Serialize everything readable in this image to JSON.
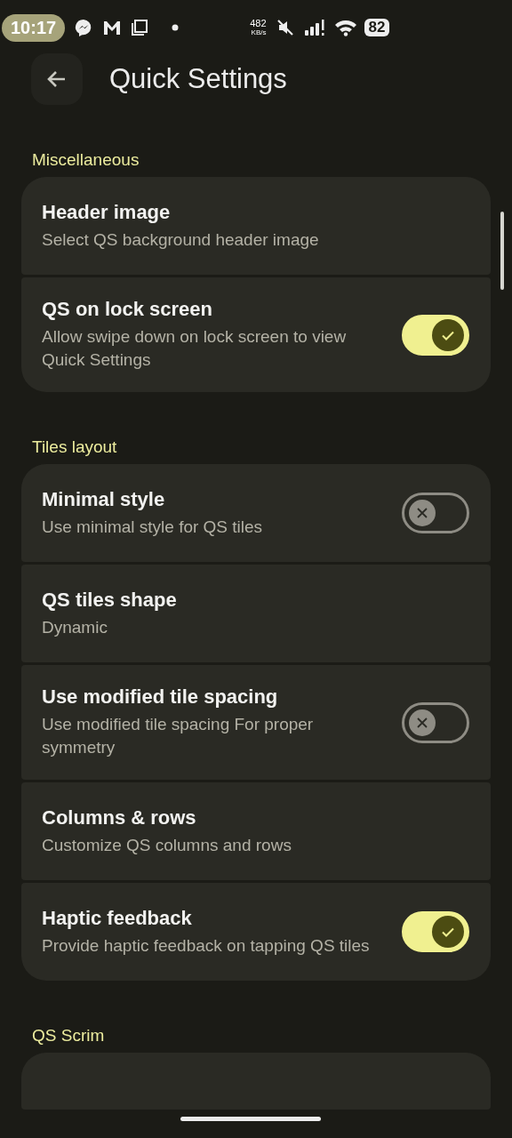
{
  "status_bar": {
    "time": "10:17",
    "speed": "482",
    "speed_unit": "KB/s",
    "battery": "82"
  },
  "header": {
    "title": "Quick Settings"
  },
  "sections": [
    {
      "title": "Miscellaneous",
      "items": [
        {
          "kind": "link",
          "title": "Header image",
          "subtitle": "Select QS background header image"
        },
        {
          "kind": "switch",
          "title": "QS on lock screen",
          "subtitle": "Allow swipe down on lock screen to view Quick Settings",
          "on": true
        }
      ]
    },
    {
      "title": "Tiles layout",
      "items": [
        {
          "kind": "switch",
          "title": "Minimal style",
          "subtitle": "Use minimal style for QS tiles",
          "on": false
        },
        {
          "kind": "link",
          "title": "QS tiles shape",
          "subtitle": "Dynamic"
        },
        {
          "kind": "switch",
          "title": "Use modified tile spacing",
          "subtitle": "Use modified tile spacing For proper symmetry",
          "on": false
        },
        {
          "kind": "link",
          "title": "Columns & rows",
          "subtitle": "Customize QS columns and rows"
        },
        {
          "kind": "switch",
          "title": "Haptic feedback",
          "subtitle": "Provide haptic feedback on tapping QS tiles",
          "on": true
        }
      ]
    },
    {
      "title": "QS Scrim",
      "items": [
        {
          "kind": "clipped"
        }
      ]
    }
  ]
}
